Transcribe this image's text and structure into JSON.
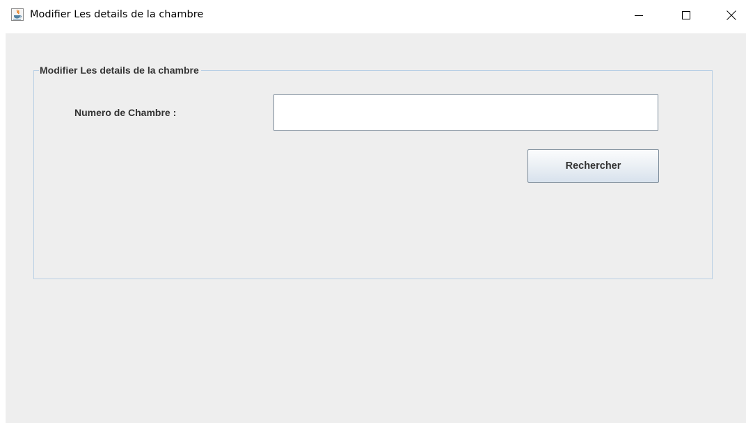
{
  "window": {
    "title": "Modifier Les details de la chambre",
    "icon": "java-app-icon",
    "controls": {
      "minimize": "minimize-icon",
      "maximize": "maximize-icon",
      "close": "close-icon"
    }
  },
  "panel": {
    "title": "Modifier Les details de la chambre",
    "room_number_label": "Numero de Chambre :",
    "room_number_value": "",
    "search_button_label": "Rechercher"
  },
  "colors": {
    "client_background": "#eeeeee",
    "group_border": "#b8cfe5",
    "label_text": "#333333"
  }
}
